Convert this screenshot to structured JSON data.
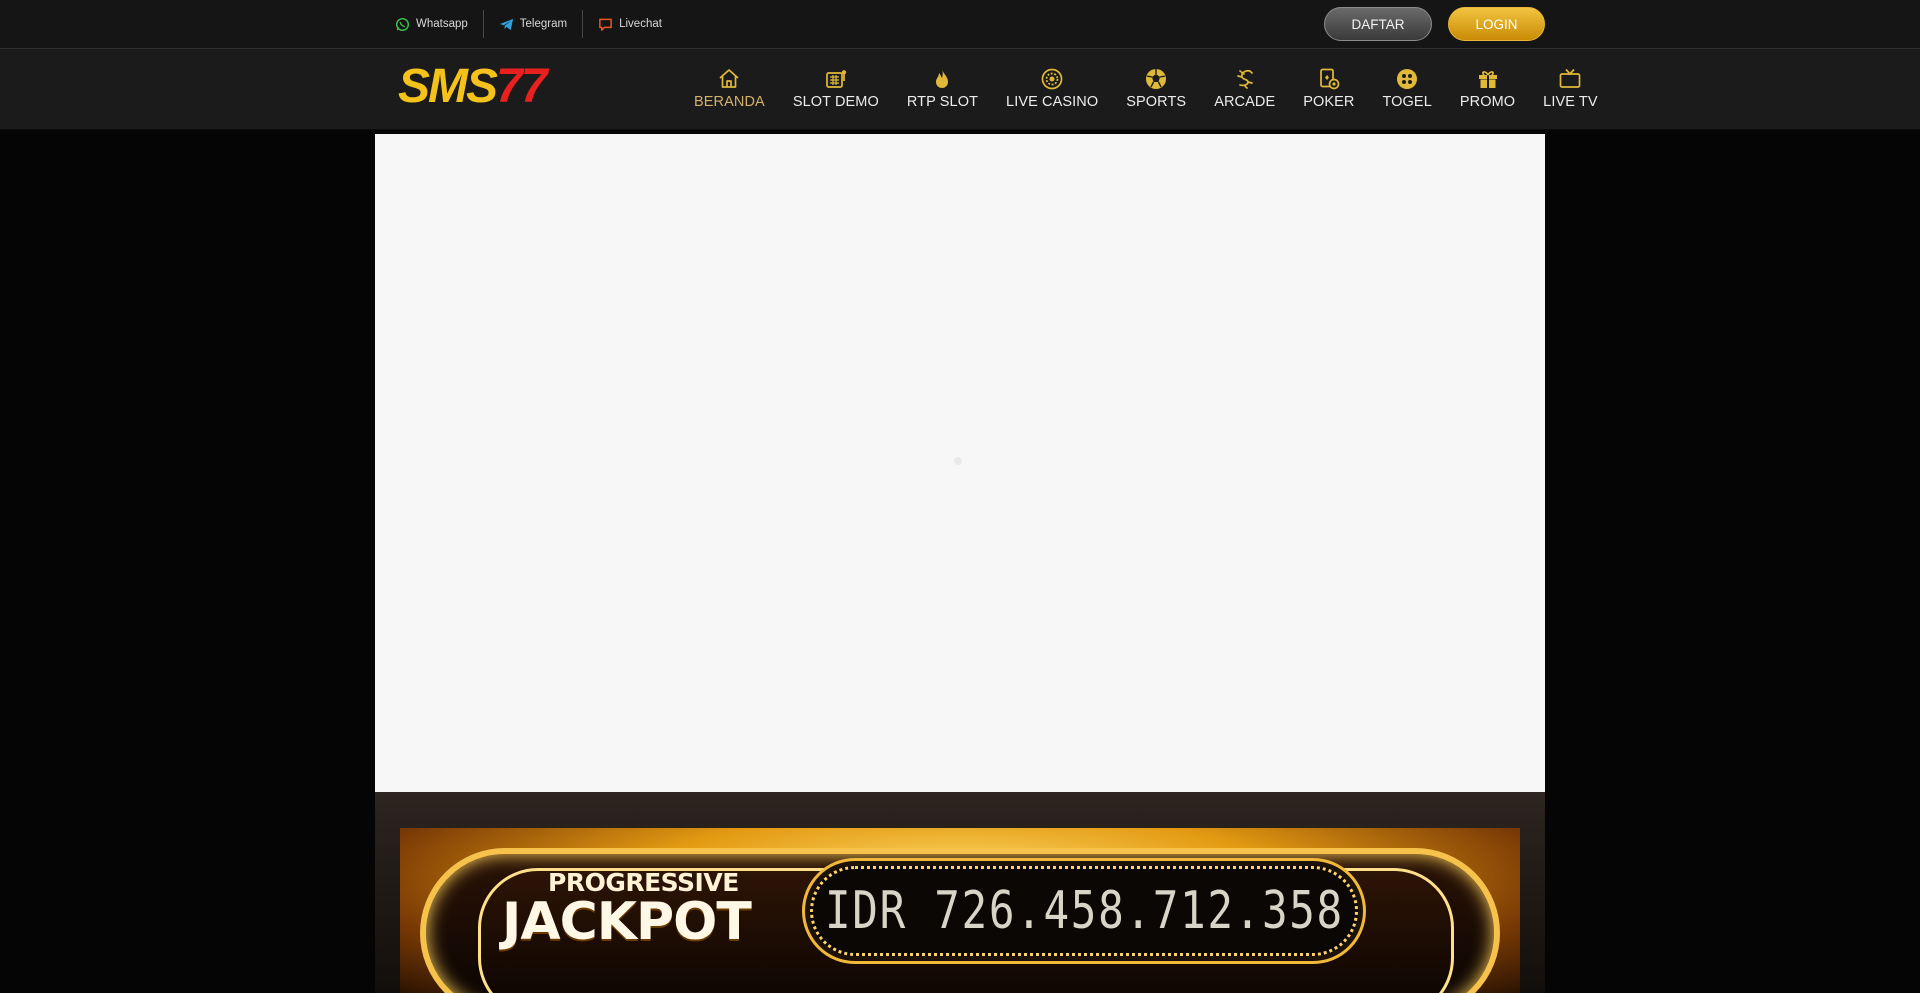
{
  "topbar": {
    "contacts": [
      {
        "label": "Whatsapp",
        "icon": "whatsapp-icon",
        "color": "#3fc24f"
      },
      {
        "label": "Telegram",
        "icon": "telegram-icon",
        "color": "#2fa3e0"
      },
      {
        "label": "Livechat",
        "icon": "chat-bubble-icon",
        "color": "#e8581f"
      }
    ],
    "daftar_label": "DAFTAR",
    "login_label": "LOGIN"
  },
  "logo": {
    "part1": "SMS",
    "part2": "77"
  },
  "nav": {
    "items": [
      {
        "label": "BERANDA",
        "icon": "home-icon",
        "active": true
      },
      {
        "label": "SLOT DEMO",
        "icon": "slot-machine-icon"
      },
      {
        "label": "RTP SLOT",
        "icon": "flame-icon"
      },
      {
        "label": "LIVE CASINO",
        "icon": "casino-chip-icon"
      },
      {
        "label": "SPORTS",
        "icon": "soccer-ball-icon"
      },
      {
        "label": "ARCADE",
        "icon": "dragon-icon"
      },
      {
        "label": "POKER",
        "icon": "poker-card-icon"
      },
      {
        "label": "TOGEL",
        "icon": "lottery-ball-icon"
      },
      {
        "label": "PROMO",
        "icon": "gift-icon"
      },
      {
        "label": "LIVE TV",
        "icon": "tv-icon"
      }
    ]
  },
  "jackpot": {
    "title_small": "PROGRESSIVE",
    "title_big": "JACKPOT",
    "amount": "IDR 726.458.712.358"
  },
  "colors": {
    "accent_gold": "#e1b93a",
    "active_nav": "#d5b06a",
    "logo_red": "#e8201e",
    "logo_yellow": "#f5c21b"
  }
}
